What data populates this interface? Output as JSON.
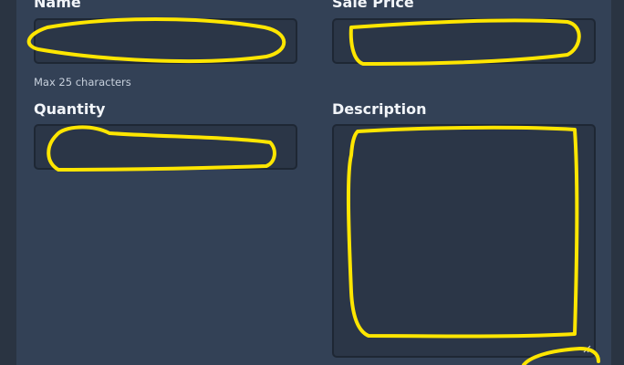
{
  "form": {
    "name": {
      "label": "Name",
      "value": "",
      "hint": "Max 25 characters"
    },
    "sale_price": {
      "label": "Sale Price",
      "value": ""
    },
    "quantity": {
      "label": "Quantity",
      "value": ""
    },
    "description": {
      "label": "Description",
      "value": ""
    }
  },
  "annotation": {
    "color": "#ffe600"
  },
  "icons": {
    "textarea_resize": "resize-grip-icon"
  }
}
